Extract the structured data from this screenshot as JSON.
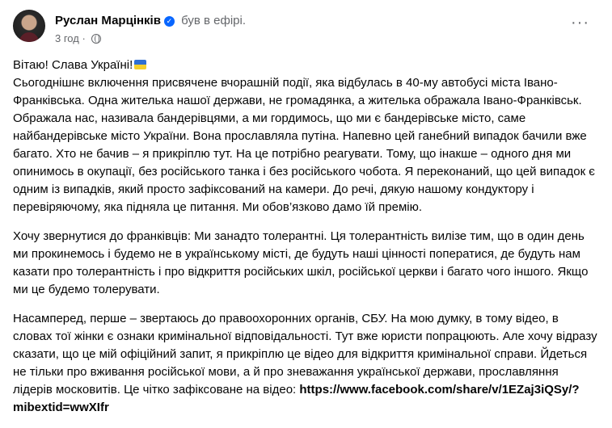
{
  "post": {
    "author": "Руслан Марцінків",
    "status": "був в ефірі.",
    "time": "3 год",
    "dot": "·",
    "more_label": "···",
    "greeting": "Вітаю! Слава Україні!",
    "paragraph1": "Сьогоднішнє включення присвячене вчорашній події, яка відбулась в 40-му автобусі міста Івано-Франківська. Одна жителька нашої держави, не громадянка, а жителька ображала Івано-Франківськ. Ображала нас, називала бандерівцями, а ми гордимось, що ми є бандерівське місто, саме найбандерівське місто України. Вона прославляла путіна. Напевно цей ганебний випадок бачили вже багато. Хто не бачив – я прикріплю тут. На це потрібно реагувати. Тому, що інакше – одного дня ми опинимось в окупації, без російського танка і без російського чобота. Я переконаний, що цей випадок є одним із випадків, який просто зафіксований на камери. До речі, дякую нашому кондуктору і перевіряючому, яка підняла це питання. Ми обов’язково дамо їй премію.",
    "paragraph2": "Хочу звернутися до франківців: Ми занадто толерантні. Ця толерантність вилізе тим, що в один день ми прокинемось і будемо не в українському місті, де будуть наші цінності поператися, де будуть нам казати про толерантність і про відкриття російських шкіл, російської церкви і багато чого іншого. Якщо ми це будемо толерувати.",
    "paragraph3": "Насамперед, перше – звертаюсь до правоохоронних органів, СБУ. На мою думку, в тому відео, в словах тої жінки є ознаки кримінальної відповідальності. Тут вже юристи попрацюють. Але хочу відразу сказати, що це мій офіційний запит, я прикріплю це відео для відкриття кримінальної справи. Йдеться не тільки про вживання російської мови, а й про зневажання української держави, прославляння лідерів московитів. Це чітко зафіксоване на відео: ",
    "link": "https://www.facebook.com/share/v/1EZaj3iQSy/?mibextid=wwXIfr"
  }
}
